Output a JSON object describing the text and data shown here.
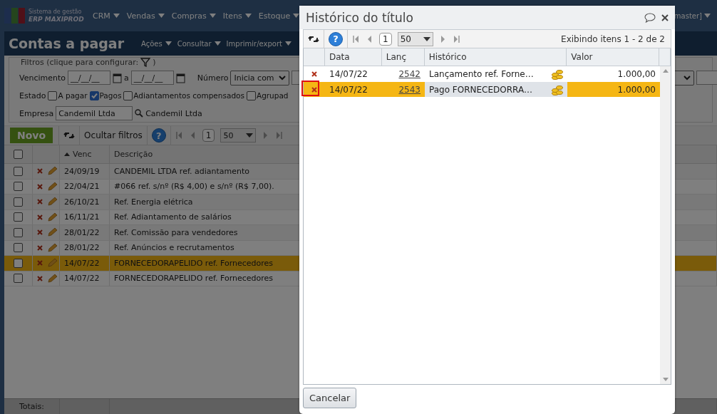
{
  "app_header": {
    "logo_line1": "Sistema de gestão",
    "logo_line2": "ERP MAXIPROD",
    "menus": [
      "CRM",
      "Vendas",
      "Compras",
      "Itens",
      "Estoque"
    ],
    "user": "master]"
  },
  "page": {
    "title": "Contas a pagar",
    "menus": [
      "Ações",
      "Consultar",
      "Imprimir/export"
    ]
  },
  "filters": {
    "legend": "Filtros (clique para configurar:",
    "legend_end": ")",
    "vencimento_label": "Vencimento",
    "date_from": "__/__/__",
    "between": "a",
    "date_to": "__/__/__",
    "numero_label": "Número",
    "numero_mode": "Inicia com",
    "estado_label": "Estado",
    "estados": [
      {
        "label": "A pagar",
        "checked": false
      },
      {
        "label": "Pagos",
        "checked": true
      },
      {
        "label": "Adiantamentos compensados",
        "checked": false
      },
      {
        "label": "Agrupad",
        "checked": false
      }
    ],
    "empresa_label": "Empresa",
    "empresa_value": "Candemil Ltda",
    "empresa_name": "Candemil Ltda"
  },
  "toolbar": {
    "new_button": "Novo",
    "hide_filters": "Ocultar filtros",
    "help": "?",
    "page": "1",
    "page_size": "50"
  },
  "table": {
    "columns": [
      "Venc",
      "Descrição"
    ],
    "all_checked": false,
    "rows": [
      {
        "venc": "24/09/19",
        "descricao": "CANDEMIL LTDA ref. adiantamento",
        "checked": false,
        "selected": false
      },
      {
        "venc": "22/04/21",
        "descricao": "#066 ref. s/nº (R$ 4,00) e s/nº (R$ 7,00).",
        "checked": false,
        "selected": false
      },
      {
        "venc": "26/10/21",
        "descricao": "Ref. Energia elétrica",
        "checked": false,
        "selected": false
      },
      {
        "venc": "16/11/21",
        "descricao": "Ref. Adiantamento de salários",
        "checked": false,
        "selected": false
      },
      {
        "venc": "28/01/22",
        "descricao": "Ref. Comissão para vendedores",
        "checked": false,
        "selected": false
      },
      {
        "venc": "28/01/22",
        "descricao": "Ref. Anúncios e recrutamentos",
        "checked": false,
        "selected": false
      },
      {
        "venc": "14/07/22",
        "descricao": "FORNECEDORAPELIDO ref. Fornecedores",
        "checked": false,
        "selected": true
      },
      {
        "venc": "14/07/22",
        "descricao": "FORNECEDORAPELIDO ref. Fornecedores",
        "checked": false,
        "selected": false
      }
    ],
    "totals_label": "Totais:"
  },
  "dialog": {
    "title": "Histórico do título",
    "help": "?",
    "page": "1",
    "page_size": "50",
    "summary": "Exibindo itens 1 - 2 de 2",
    "columns": [
      "Data",
      "Lanç",
      "Histórico",
      "Valor"
    ],
    "rows": [
      {
        "data": "14/07/22",
        "lanc": "2542",
        "historico": "Lançamento ref. Forne…",
        "valor": "1.000,00",
        "selected": false,
        "highlighted": false
      },
      {
        "data": "14/07/22",
        "lanc": "2543",
        "historico": "Pago FORNECEDORRA…",
        "valor": "1.000,00",
        "selected": true,
        "highlighted": true
      }
    ],
    "cancel_button": "Cancelar"
  }
}
